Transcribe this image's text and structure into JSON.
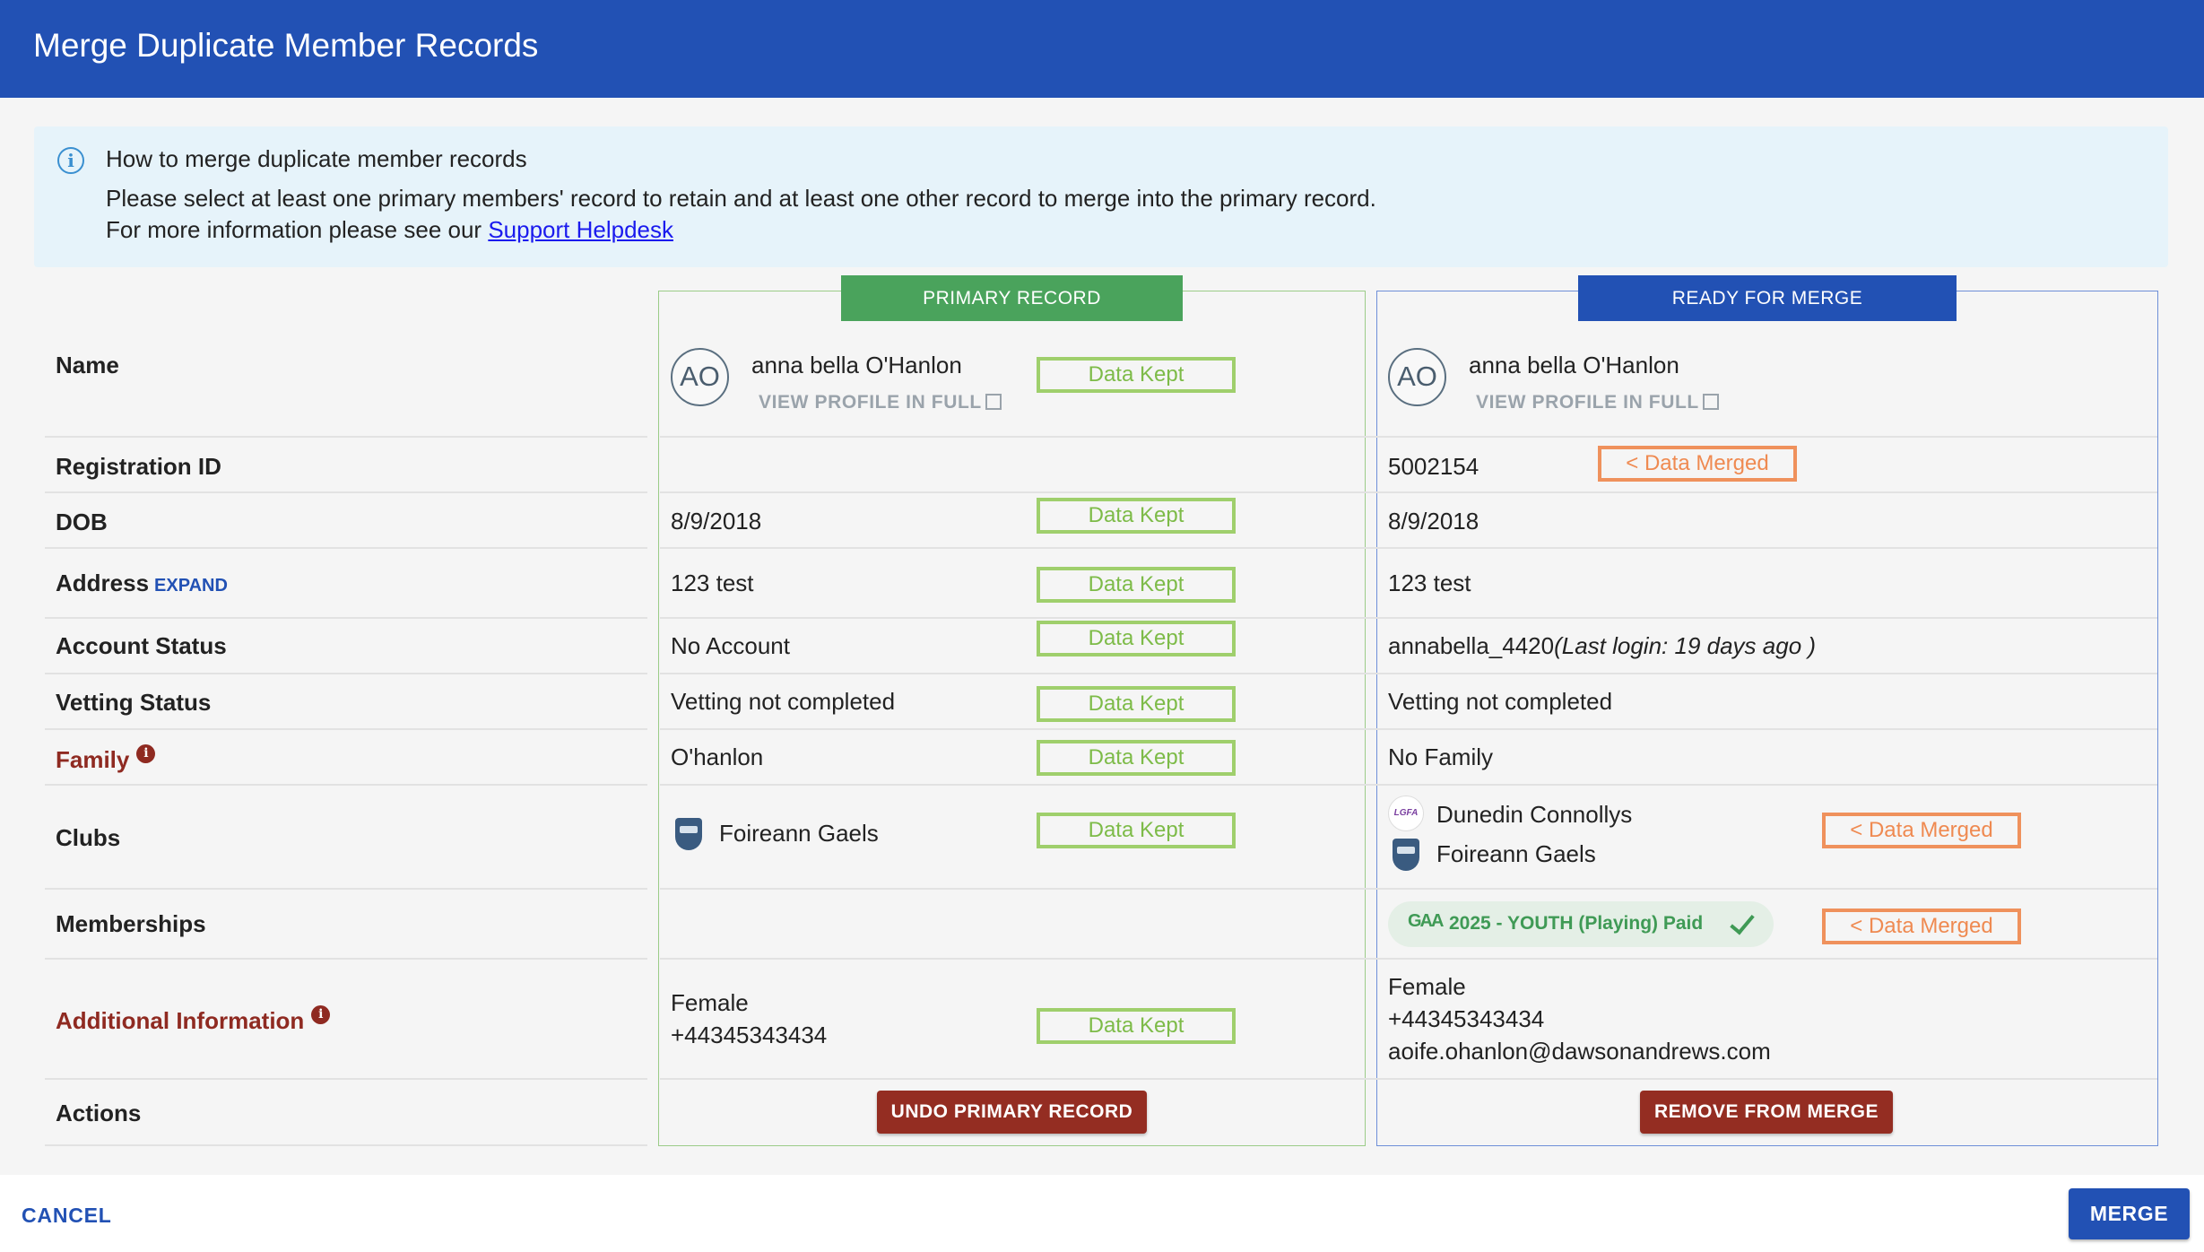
{
  "dialog": {
    "title": "Merge Duplicate Member Records"
  },
  "info": {
    "heading": "How to merge duplicate member records",
    "line1": "Please select at least one primary members' record to retain and at least one other record to merge into the primary record.",
    "line2_prefix": "For more information please see our ",
    "link": "Support Helpdesk"
  },
  "labels": {
    "name": "Name",
    "registration_id": "Registration ID",
    "dob": "DOB",
    "address": "Address",
    "address_expand": "EXPAND",
    "account_status": "Account Status",
    "vetting_status": "Vetting Status",
    "family": "Family",
    "clubs": "Clubs",
    "memberships": "Memberships",
    "additional_information": "Additional Information",
    "actions": "Actions"
  },
  "primary": {
    "badge": "PRIMARY RECORD",
    "initials": "AO",
    "name": "anna bella O'Hanlon",
    "view_profile": "VIEW PROFILE IN FULL",
    "registration_id": "",
    "dob": "8/9/2018",
    "address": "123 test",
    "account_status": "No Account",
    "vetting_status": "Vetting not completed",
    "family": "O'hanlon",
    "clubs": [
      "Foireann Gaels"
    ],
    "additional_info": [
      "Female",
      "+44345343434"
    ],
    "action_button": "UNDO PRIMARY RECORD"
  },
  "merge": {
    "badge": "READY FOR MERGE",
    "initials": "AO",
    "name": "anna bella O'Hanlon",
    "view_profile": "VIEW PROFILE IN FULL",
    "registration_id": "5002154",
    "dob": "8/9/2018",
    "address": "123 test",
    "account_status": "annabella_4420",
    "account_last_login": "(Last login: 19 days ago )",
    "vetting_status": "Vetting not completed",
    "family": "No Family",
    "clubs": [
      "Dunedin Connollys",
      "Foireann Gaels"
    ],
    "club_logo_text": "LGFA",
    "membership": "2025 - YOUTH (Playing) Paid",
    "membership_logo_text": "GAA",
    "additional_info": [
      "Female",
      "+44345343434",
      "aoife.ohanlon@dawsonandrews.com"
    ],
    "action_button": "REMOVE FROM MERGE"
  },
  "tags": {
    "kept": "Data Kept",
    "merged": "< Data Merged"
  },
  "footer": {
    "cancel": "CANCEL",
    "merge": "MERGE"
  },
  "colors": {
    "header": "#2251b4",
    "kept": "#9fcf6c",
    "merged": "#ef915c",
    "action": "#942d22",
    "primary_badge": "#4aa35c"
  }
}
